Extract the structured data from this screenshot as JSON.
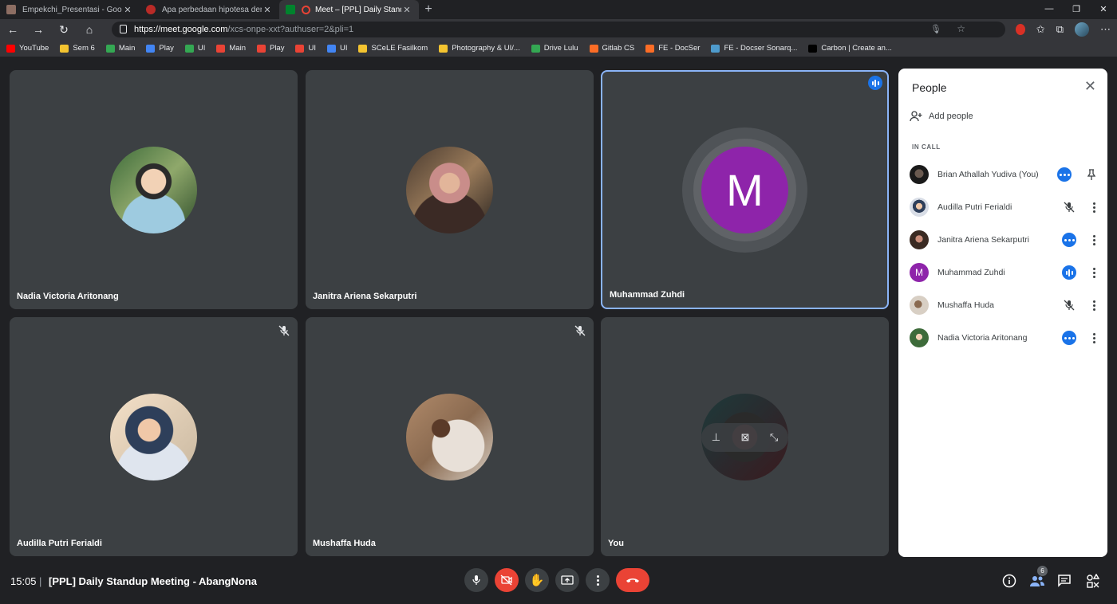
{
  "browser": {
    "tabs": [
      {
        "title": "Empekchi_Presentasi - Google S",
        "favicon_color": "#8d6e63"
      },
      {
        "title": "Apa perbedaan hipotesa dengan",
        "favicon_color": "#b92b27"
      },
      {
        "title": "Meet – [PPL] Daily Standup",
        "favicon_color": "#ea4335"
      }
    ],
    "new_tab": "+",
    "url_host": "https://meet.google.com",
    "url_path": "/xcs-onpe-xxt?authuser=2&pli=1",
    "bookmarks": [
      {
        "label": "YouTube",
        "color": "#ff0000"
      },
      {
        "label": "Sem 6",
        "color": "#f4c430"
      },
      {
        "label": "Main",
        "color": "#34a853"
      },
      {
        "label": "Play",
        "color": "#4285f4"
      },
      {
        "label": "UI",
        "color": "#34a853"
      },
      {
        "label": "Main",
        "color": "#ea4335"
      },
      {
        "label": "Play",
        "color": "#ea4335"
      },
      {
        "label": "UI",
        "color": "#ea4335"
      },
      {
        "label": "UI",
        "color": "#4285f4"
      },
      {
        "label": "SCeLE Fasilkom",
        "color": "#f4c430"
      },
      {
        "label": "Photography & UI/...",
        "color": "#f4c430"
      },
      {
        "label": "Drive Lulu",
        "color": "#34a853"
      },
      {
        "label": "Gitlab CS",
        "color": "#fc6d26"
      },
      {
        "label": "FE - DocSer",
        "color": "#fc6d26"
      },
      {
        "label": "FE - Docser Sonarq...",
        "color": "#4e9bcd"
      },
      {
        "label": "Carbon | Create an...",
        "color": "#000000"
      }
    ]
  },
  "meet": {
    "tiles": [
      {
        "name": "Nadia Victoria Aritonang"
      },
      {
        "name": "Janitra Ariena Sekarputri"
      },
      {
        "name": "Muhammad Zuhdi",
        "initial": "M"
      },
      {
        "name": "Audilla Putri Ferialdi"
      },
      {
        "name": "Mushaffa Huda"
      },
      {
        "name": "You"
      }
    ],
    "people_panel": {
      "title": "People",
      "add_people": "Add people",
      "section": "IN CALL",
      "participants": [
        {
          "name": "Brian Athallah Yudiva (You)",
          "status": "talking-dots"
        },
        {
          "name": "Audilla Putri Ferialdi",
          "status": "muted"
        },
        {
          "name": "Janitra Ariena Sekarputri",
          "status": "talking-dots"
        },
        {
          "name": "Muhammad Zuhdi",
          "status": "speaking",
          "initial": "M"
        },
        {
          "name": "Mushaffa Huda",
          "status": "muted"
        },
        {
          "name": "Nadia Victoria Aritonang",
          "status": "talking-dots"
        }
      ]
    },
    "bottom_bar": {
      "time": "15:05",
      "separator": "|",
      "meeting_title": "[PPL] Daily Standup Meeting - AbangNona",
      "participant_count": "6"
    },
    "colors": {
      "accent": "#1a73e8",
      "danger": "#ea4335",
      "avatar_m": "#8e24aa"
    }
  }
}
